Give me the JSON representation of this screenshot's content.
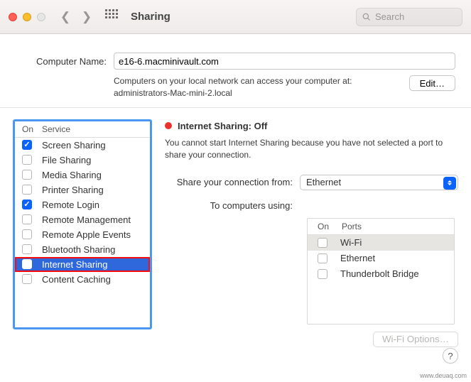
{
  "toolbar": {
    "title": "Sharing",
    "search_placeholder": "Search"
  },
  "computer_name": {
    "label": "Computer Name:",
    "value": "e16-6.macminivault.com",
    "access_line1": "Computers on your local network can access your computer at:",
    "access_line2": "administrators-Mac-mini-2.local",
    "edit_label": "Edit…"
  },
  "services": {
    "head_on": "On",
    "head_service": "Service",
    "items": [
      {
        "label": "Screen Sharing",
        "checked": true
      },
      {
        "label": "File Sharing",
        "checked": false
      },
      {
        "label": "Media Sharing",
        "checked": false
      },
      {
        "label": "Printer Sharing",
        "checked": false
      },
      {
        "label": "Remote Login",
        "checked": true
      },
      {
        "label": "Remote Management",
        "checked": false
      },
      {
        "label": "Remote Apple Events",
        "checked": false
      },
      {
        "label": "Bluetooth Sharing",
        "checked": false
      },
      {
        "label": "Internet Sharing",
        "checked": false,
        "selected": true
      },
      {
        "label": "Content Caching",
        "checked": false
      }
    ]
  },
  "detail": {
    "title": "Internet Sharing: Off",
    "description": "You cannot start Internet Sharing because you have not selected a port to share your connection.",
    "share_from_label": "Share your connection from:",
    "share_from_value": "Ethernet",
    "to_computers_label": "To computers using:",
    "ports_head_on": "On",
    "ports_head_ports": "Ports",
    "ports": [
      {
        "label": "Wi-Fi",
        "checked": false,
        "selected": true
      },
      {
        "label": "Ethernet",
        "checked": false
      },
      {
        "label": "Thunderbolt Bridge",
        "checked": false
      }
    ],
    "wifi_options_label": "Wi-Fi Options…"
  },
  "watermark": "www.deuaq.com"
}
